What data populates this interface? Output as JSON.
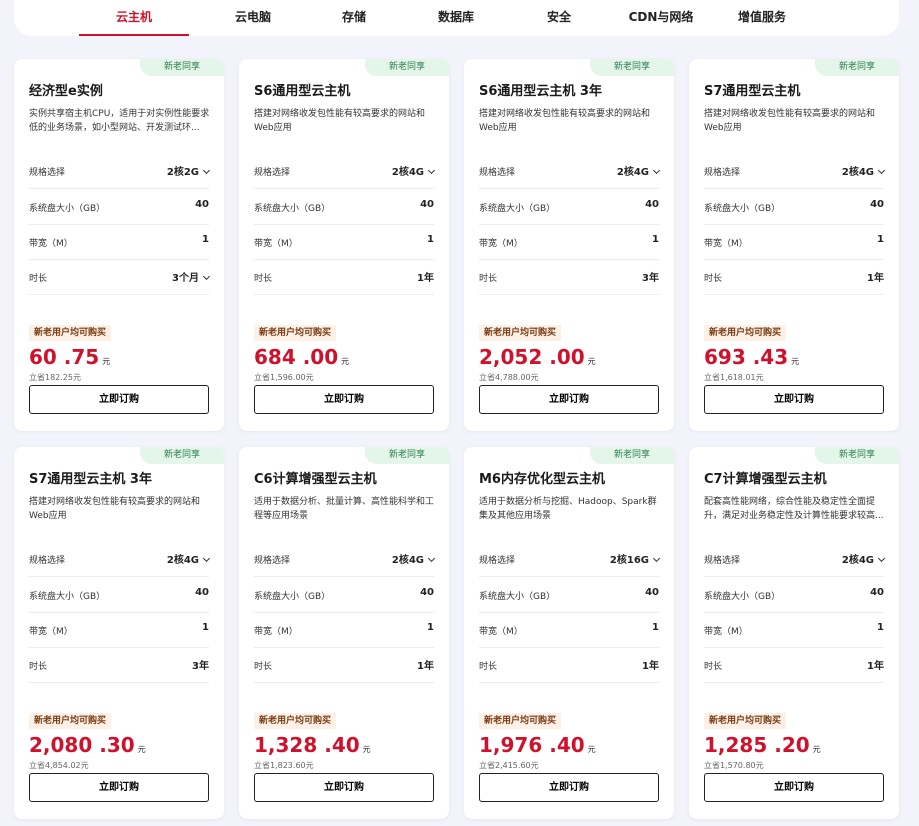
{
  "tabs": [
    "云主机",
    "云电脑",
    "存储",
    "数据库",
    "安全",
    "CDN与网络",
    "增值服务"
  ],
  "labels": {
    "spec": "规格选择",
    "disk": "系统盘大小（GB）",
    "bandwidth": "带宽（M）",
    "duration": "时长",
    "promo": "新老用户均可购买",
    "buy": "立即订购",
    "badge": "新老同享",
    "currency_unit": "元"
  },
  "cards": [
    {
      "title": "经济型e实例",
      "desc": "实例共享宿主机CPU，适用于对实例性能要求低的业务场景，如小型网站、开发测试环...",
      "spec": "2核2G",
      "disk": "40",
      "bandwidth": "1",
      "duration": "3个月",
      "duration_select": true,
      "price": "60 .75",
      "save": "立省182.25元"
    },
    {
      "title": "S6通用型云主机",
      "desc": "搭建对网络收发包性能有较高要求的网站和Web应用",
      "spec": "2核4G",
      "disk": "40",
      "bandwidth": "1",
      "duration": "1年",
      "duration_select": false,
      "price": "684 .00",
      "save": "立省1,596.00元"
    },
    {
      "title": "S6通用型云主机 3年",
      "desc": "搭建对网络收发包性能有较高要求的网站和Web应用",
      "spec": "2核4G",
      "disk": "40",
      "bandwidth": "1",
      "duration": "3年",
      "duration_select": false,
      "price": "2,052 .00",
      "save": "立省4,788.00元"
    },
    {
      "title": "S7通用型云主机",
      "desc": "搭建对网络收发包性能有较高要求的网站和Web应用",
      "spec": "2核4G",
      "disk": "40",
      "bandwidth": "1",
      "duration": "1年",
      "duration_select": false,
      "price": "693 .43",
      "save": "立省1,618.01元"
    },
    {
      "title": "S7通用型云主机 3年",
      "desc": "搭建对网络收发包性能有较高要求的网站和Web应用",
      "spec": "2核4G",
      "disk": "40",
      "bandwidth": "1",
      "duration": "3年",
      "duration_select": false,
      "price": "2,080 .30",
      "save": "立省4,854.02元"
    },
    {
      "title": "C6计算增强型云主机",
      "desc": "适用于数据分析、批量计算、高性能科学和工程等应用场景",
      "spec": "2核4G",
      "disk": "40",
      "bandwidth": "1",
      "duration": "1年",
      "duration_select": false,
      "price": "1,328 .40",
      "save": "立省1,823.60元"
    },
    {
      "title": "M6内存优化型云主机",
      "desc": "适用于数据分析与挖掘、Hadoop、Spark群集及其他应用场景",
      "spec": "2核16G",
      "disk": "40",
      "bandwidth": "1",
      "duration": "1年",
      "duration_select": false,
      "price": "1,976 .40",
      "save": "立省2,415.60元"
    },
    {
      "title": "C7计算增强型云主机",
      "desc": "配套高性能网络，综合性能及稳定性全面提升，满足对业务稳定性及计算性能要求较高...",
      "spec": "2核4G",
      "disk": "40",
      "bandwidth": "1",
      "duration": "1年",
      "duration_select": false,
      "price": "1,285 .20",
      "save": "立省1,570.80元"
    }
  ]
}
